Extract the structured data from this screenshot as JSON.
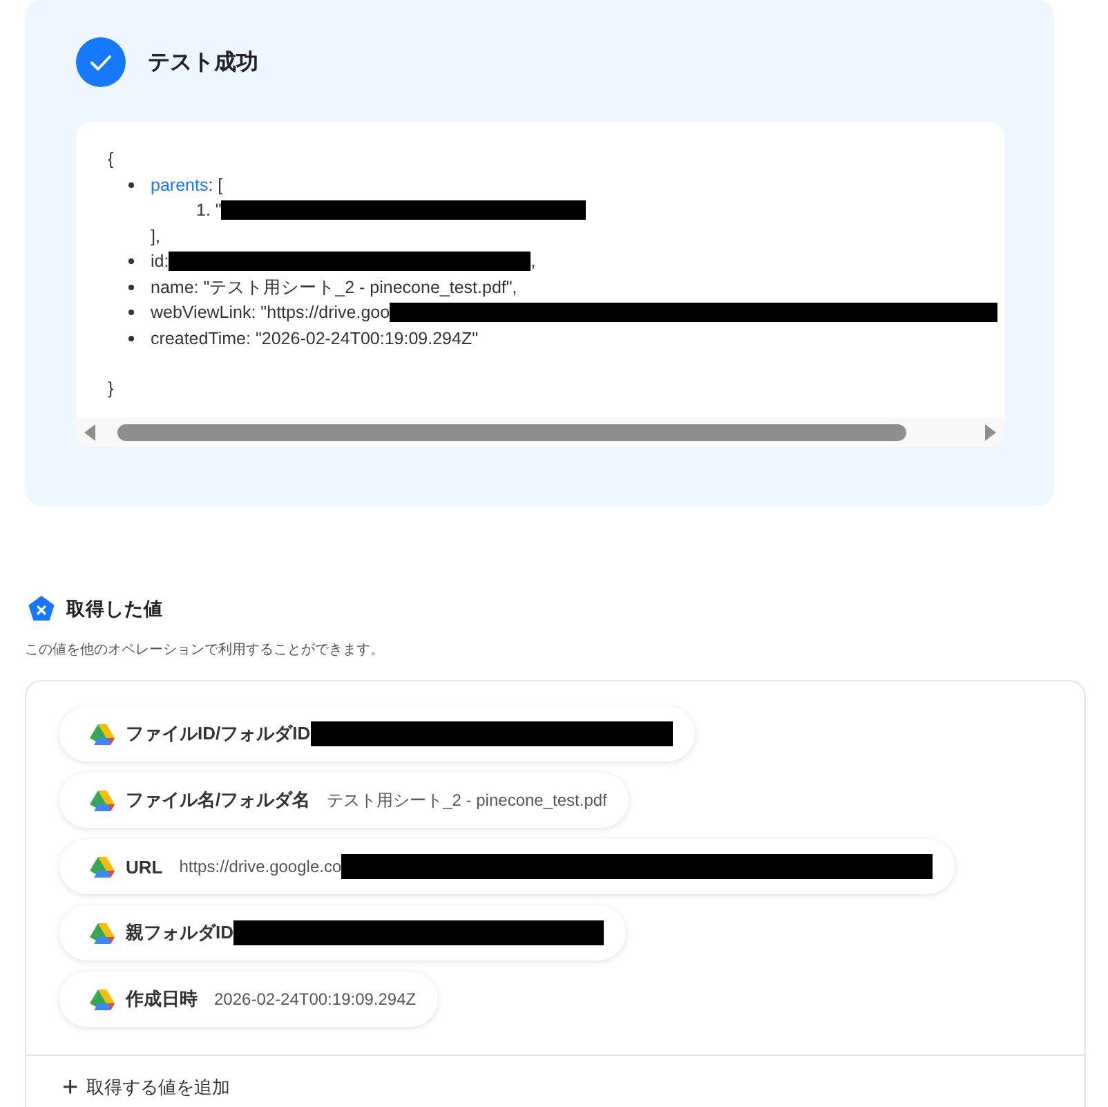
{
  "result": {
    "title": "テスト成功",
    "code": {
      "open": "{",
      "close": "}",
      "lines": [
        {
          "key": "parents",
          "expandable": true,
          "text": ": [",
          "items": [
            {
              "marker": "1.",
              "text": "\"",
              "redacted": true
            }
          ],
          "end": "],"
        },
        {
          "key": "id",
          "expandable": false,
          "text": ": ",
          "redacted": true,
          "after": ","
        },
        {
          "key": "name",
          "expandable": false,
          "text": ": \"テスト用シート_2 - pinecone_test.pdf\","
        },
        {
          "key": "webViewLink",
          "expandable": false,
          "text": ": \"https://drive.goo",
          "redacted": true
        },
        {
          "key": "createdTime",
          "expandable": false,
          "text": ": \"2026-02-24T00:19:09.294Z\""
        }
      ]
    }
  },
  "values": {
    "title": "取得した値",
    "description": "この値を他のオペレーションで利用することができます。",
    "items": [
      {
        "label": "ファイルID/フォルダID",
        "redacted": true
      },
      {
        "label": "ファイル名/フォルダ名",
        "value": "テスト用シート_2 - pinecone_test.pdf"
      },
      {
        "label": "URL",
        "value": "https://drive.google.co",
        "redacted": true
      },
      {
        "label": "親フォルダID",
        "redacted": true
      },
      {
        "label": "作成日時",
        "value": "2026-02-24T00:19:09.294Z"
      }
    ],
    "add_button": {
      "icon": "+",
      "label": "取得する値を追加"
    }
  }
}
